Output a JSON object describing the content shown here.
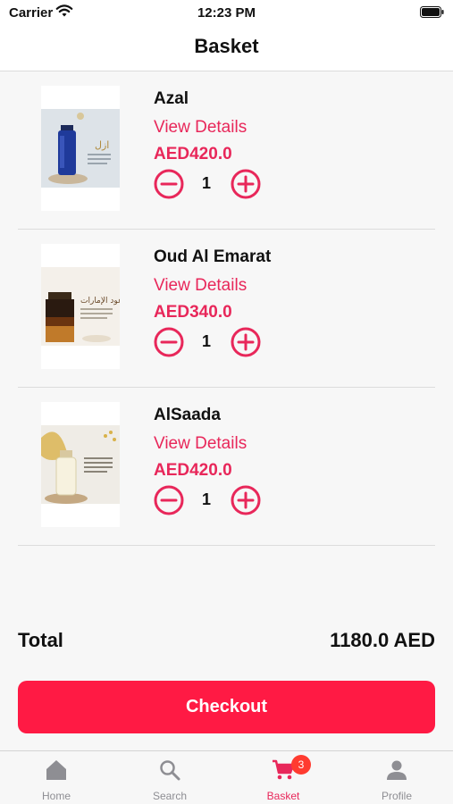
{
  "status_bar": {
    "carrier": "Carrier",
    "time": "12:23 PM"
  },
  "header": {
    "title": "Basket"
  },
  "items": [
    {
      "name": "Azal",
      "details_label": "View Details",
      "price": "AED420.0",
      "quantity": "1"
    },
    {
      "name": "Oud Al Emarat",
      "details_label": "View Details",
      "price": "AED340.0",
      "quantity": "1"
    },
    {
      "name": "AlSaada",
      "details_label": "View Details",
      "price": "AED420.0",
      "quantity": "1"
    }
  ],
  "summary": {
    "total_label": "Total",
    "total_value": "1180.0 AED"
  },
  "checkout": {
    "label": "Checkout"
  },
  "tabs": [
    {
      "label": "Home",
      "icon": "home-icon"
    },
    {
      "label": "Search",
      "icon": "search-icon"
    },
    {
      "label": "Basket",
      "icon": "cart-icon",
      "badge": "3",
      "active": true
    },
    {
      "label": "Profile",
      "icon": "person-icon"
    }
  ],
  "colors": {
    "accent": "#e8275a",
    "checkout": "#ff1a44",
    "badge": "#ff3b30",
    "tab_inactive": "#8e8e93"
  }
}
